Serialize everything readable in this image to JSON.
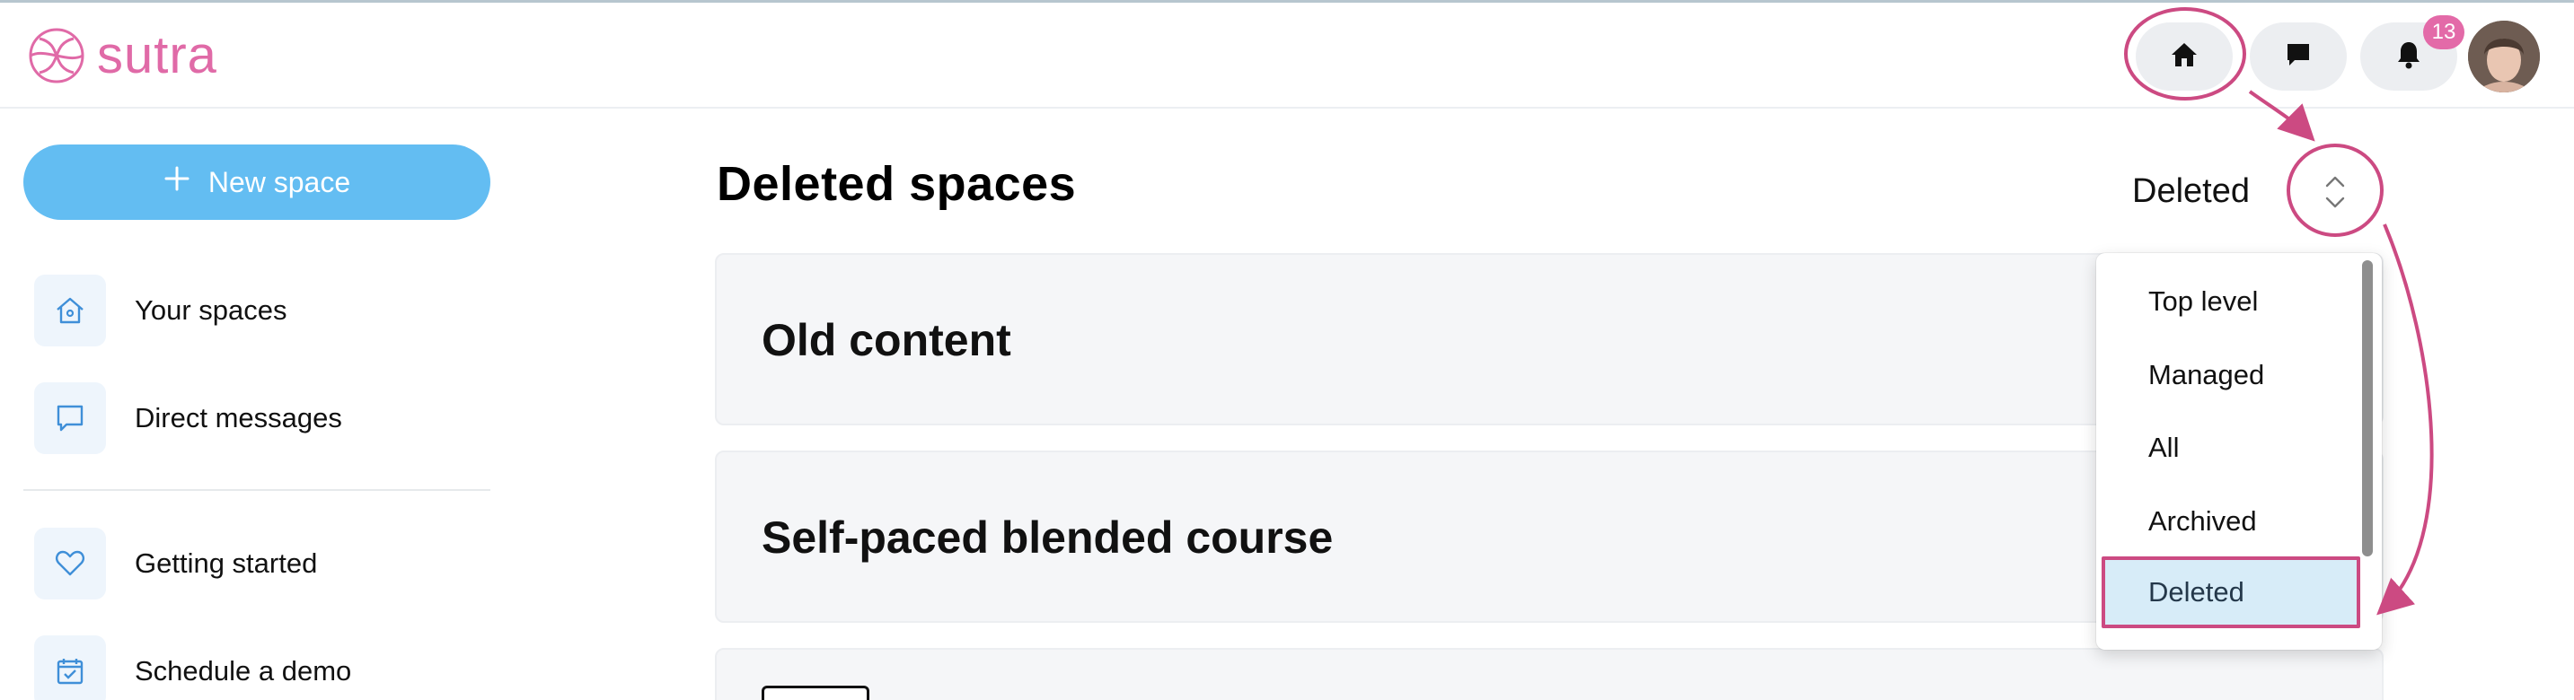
{
  "header": {
    "logo_text": "sutra",
    "notification_count": "13",
    "buttons": [
      {
        "icon": "home-icon"
      },
      {
        "icon": "chat-icon"
      },
      {
        "icon": "bell-icon"
      }
    ]
  },
  "sidebar": {
    "new_space_label": "New space",
    "items": [
      {
        "label": "Your spaces",
        "icon": "home-outline-icon"
      },
      {
        "label": "Direct messages",
        "icon": "message-outline-icon"
      },
      {
        "label": "Getting started",
        "icon": "heart-outline-icon"
      },
      {
        "label": "Schedule a demo",
        "icon": "calendar-check-icon"
      }
    ]
  },
  "main": {
    "title": "Deleted spaces",
    "filter_value": "Deleted",
    "cards": [
      {
        "title": "Old content"
      },
      {
        "title": "Self-paced blended course"
      }
    ]
  },
  "dropdown": {
    "options": [
      "Top level",
      "Managed",
      "All",
      "Archived",
      "Deleted"
    ],
    "selected": "Deleted"
  },
  "colors": {
    "brand": "#e06aa7",
    "primary_button": "#63bdf2",
    "annotation": "#cc4a82",
    "selected_bg": "#d7ecf8"
  }
}
